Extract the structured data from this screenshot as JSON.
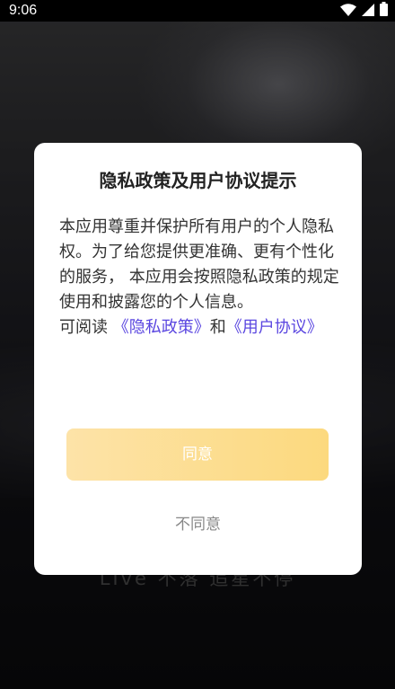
{
  "status_bar": {
    "time": "9:06"
  },
  "background": {
    "slogan": "LIve 不落 追星不停"
  },
  "dialog": {
    "title": "隐私政策及用户协议提示",
    "body": "本应用尊重并保护所有用户的个人隐私权。为了给您提供更准确、更有个性化的服务， 本应用会按照隐私政策的规定使用和披露您的个人信息。",
    "links_prefix": "可阅读 ",
    "privacy_link": "《隐私政策》",
    "links_joiner": "和",
    "terms_link": "《用户协议》",
    "agree_label": "同意",
    "disagree_label": "不同意"
  },
  "colors": {
    "link": "#5a46e0",
    "agree_button_start": "#fde3a8",
    "agree_button_end": "#fcd97e"
  }
}
